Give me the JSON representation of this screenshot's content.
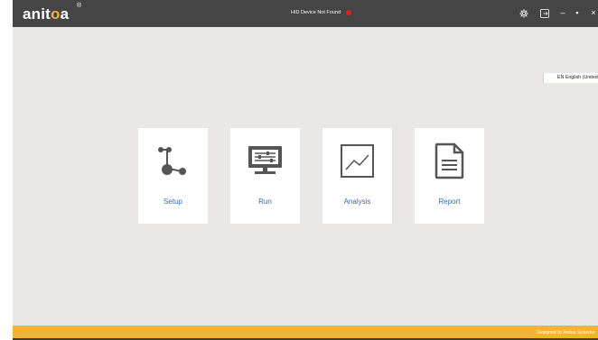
{
  "app": {
    "logo_prefix": "anit",
    "logo_o": "o",
    "logo_suffix": "a",
    "logo_mark": "®",
    "device_status": "HID Device Not Found",
    "device_status_color": "#e0201d",
    "accent_color": "#f3b335",
    "link_color": "#2f6dbd"
  },
  "titlebar": {
    "icons": [
      "gear-icon",
      "exit-icon"
    ],
    "minimize_label": "–",
    "maximize_label": "▪",
    "close_label": "×"
  },
  "language": {
    "selected": "EN English (United States)"
  },
  "tiles": [
    {
      "label": "Setup",
      "icon": "setup-network-icon"
    },
    {
      "label": "Run",
      "icon": "monitor-sliders-icon"
    },
    {
      "label": "Analysis",
      "icon": "line-chart-icon"
    },
    {
      "label": "Report",
      "icon": "document-icon"
    }
  ],
  "footer": {
    "text": "Designed by Anitoa Systems"
  }
}
